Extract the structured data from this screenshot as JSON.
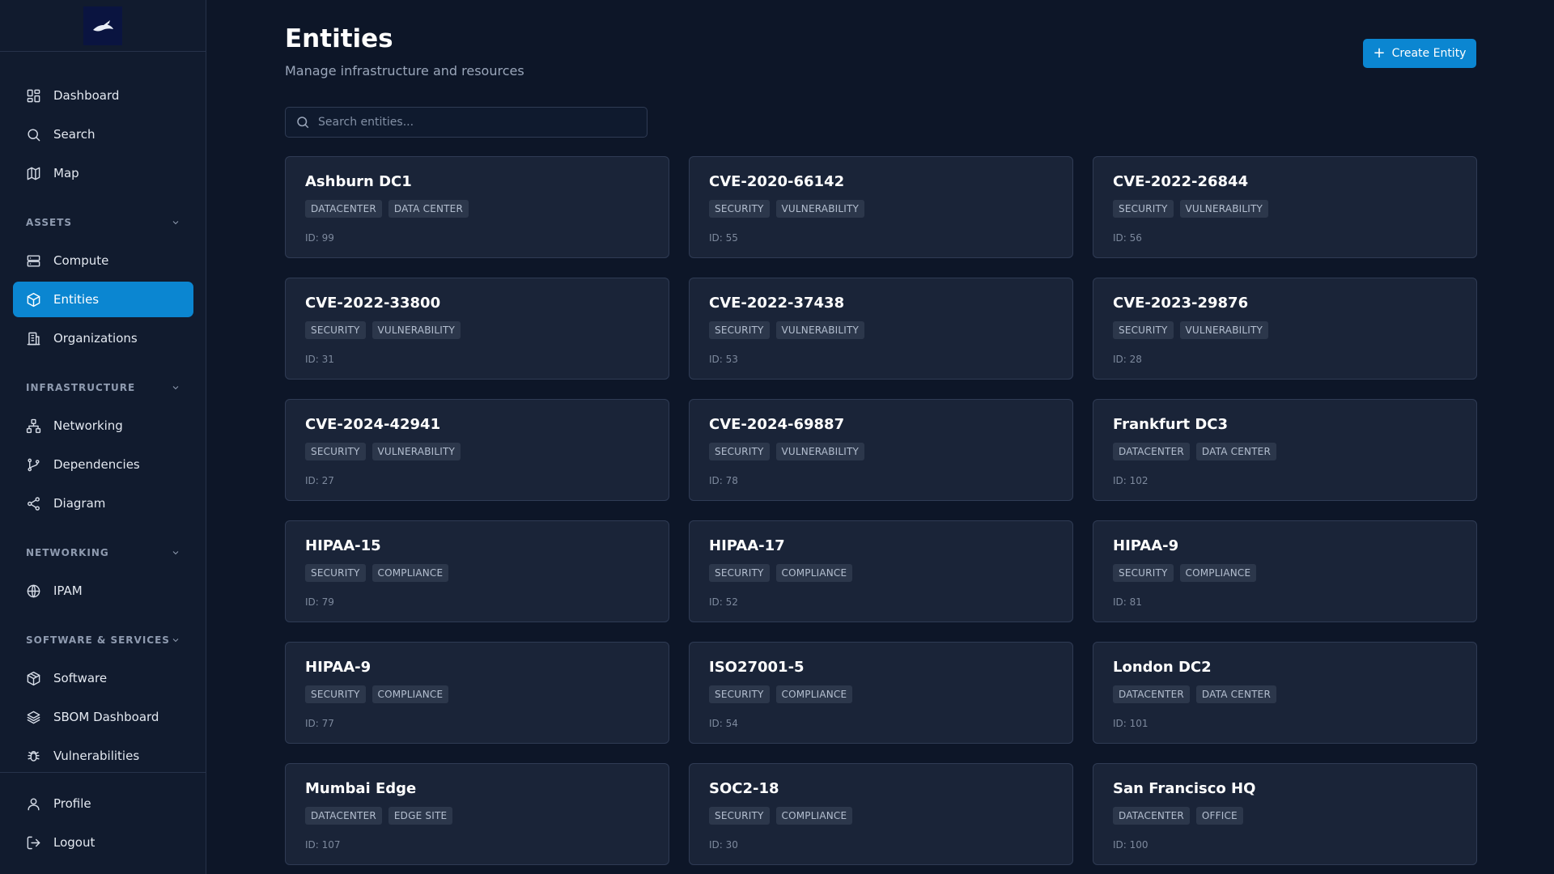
{
  "sidebar": {
    "main_items": [
      {
        "label": "Dashboard",
        "icon": "dashboard-icon"
      },
      {
        "label": "Search",
        "icon": "search-icon"
      },
      {
        "label": "Map",
        "icon": "map-icon"
      }
    ],
    "sections": [
      {
        "label": "ASSETS",
        "items": [
          {
            "label": "Compute",
            "icon": "server-icon"
          },
          {
            "label": "Entities",
            "icon": "cube-icon",
            "active": true
          },
          {
            "label": "Organizations",
            "icon": "building-icon"
          }
        ]
      },
      {
        "label": "INFRASTRUCTURE",
        "items": [
          {
            "label": "Networking",
            "icon": "network-icon"
          },
          {
            "label": "Dependencies",
            "icon": "git-branch-icon"
          },
          {
            "label": "Diagram",
            "icon": "share-icon"
          }
        ]
      },
      {
        "label": "NETWORKING",
        "items": [
          {
            "label": "IPAM",
            "icon": "globe-icon"
          }
        ]
      },
      {
        "label": "SOFTWARE & SERVICES",
        "items": [
          {
            "label": "Software",
            "icon": "package-icon"
          },
          {
            "label": "SBOM Dashboard",
            "icon": "layers-icon"
          },
          {
            "label": "Vulnerabilities",
            "icon": "bug-icon"
          }
        ]
      }
    ],
    "footer_items": [
      {
        "label": "Profile",
        "icon": "user-icon"
      },
      {
        "label": "Logout",
        "icon": "logout-icon"
      }
    ]
  },
  "header": {
    "title": "Entities",
    "subtitle": "Manage infrastructure and resources",
    "create_label": "Create Entity"
  },
  "search": {
    "placeholder": "Search entities..."
  },
  "entities": [
    {
      "name": "Ashburn DC1",
      "tags": [
        "DATACENTER",
        "DATA CENTER"
      ],
      "id": "ID: 99"
    },
    {
      "name": "CVE-2020-66142",
      "tags": [
        "SECURITY",
        "VULNERABILITY"
      ],
      "id": "ID: 55"
    },
    {
      "name": "CVE-2022-26844",
      "tags": [
        "SECURITY",
        "VULNERABILITY"
      ],
      "id": "ID: 56"
    },
    {
      "name": "CVE-2022-33800",
      "tags": [
        "SECURITY",
        "VULNERABILITY"
      ],
      "id": "ID: 31"
    },
    {
      "name": "CVE-2022-37438",
      "tags": [
        "SECURITY",
        "VULNERABILITY"
      ],
      "id": "ID: 53"
    },
    {
      "name": "CVE-2023-29876",
      "tags": [
        "SECURITY",
        "VULNERABILITY"
      ],
      "id": "ID: 28"
    },
    {
      "name": "CVE-2024-42941",
      "tags": [
        "SECURITY",
        "VULNERABILITY"
      ],
      "id": "ID: 27"
    },
    {
      "name": "CVE-2024-69887",
      "tags": [
        "SECURITY",
        "VULNERABILITY"
      ],
      "id": "ID: 78"
    },
    {
      "name": "Frankfurt DC3",
      "tags": [
        "DATACENTER",
        "DATA CENTER"
      ],
      "id": "ID: 102"
    },
    {
      "name": "HIPAA-15",
      "tags": [
        "SECURITY",
        "COMPLIANCE"
      ],
      "id": "ID: 79"
    },
    {
      "name": "HIPAA-17",
      "tags": [
        "SECURITY",
        "COMPLIANCE"
      ],
      "id": "ID: 52"
    },
    {
      "name": "HIPAA-9",
      "tags": [
        "SECURITY",
        "COMPLIANCE"
      ],
      "id": "ID: 81"
    },
    {
      "name": "HIPAA-9",
      "tags": [
        "SECURITY",
        "COMPLIANCE"
      ],
      "id": "ID: 77"
    },
    {
      "name": "ISO27001-5",
      "tags": [
        "SECURITY",
        "COMPLIANCE"
      ],
      "id": "ID: 54"
    },
    {
      "name": "London DC2",
      "tags": [
        "DATACENTER",
        "DATA CENTER"
      ],
      "id": "ID: 101"
    },
    {
      "name": "Mumbai Edge",
      "tags": [
        "DATACENTER",
        "EDGE SITE"
      ],
      "id": "ID: 107"
    },
    {
      "name": "SOC2-18",
      "tags": [
        "SECURITY",
        "COMPLIANCE"
      ],
      "id": "ID: 30"
    },
    {
      "name": "San Francisco HQ",
      "tags": [
        "DATACENTER",
        "OFFICE"
      ],
      "id": "ID: 100"
    }
  ],
  "colors": {
    "accent": "#0b86d1",
    "background": "#0d1628",
    "card": "#1a2438"
  }
}
